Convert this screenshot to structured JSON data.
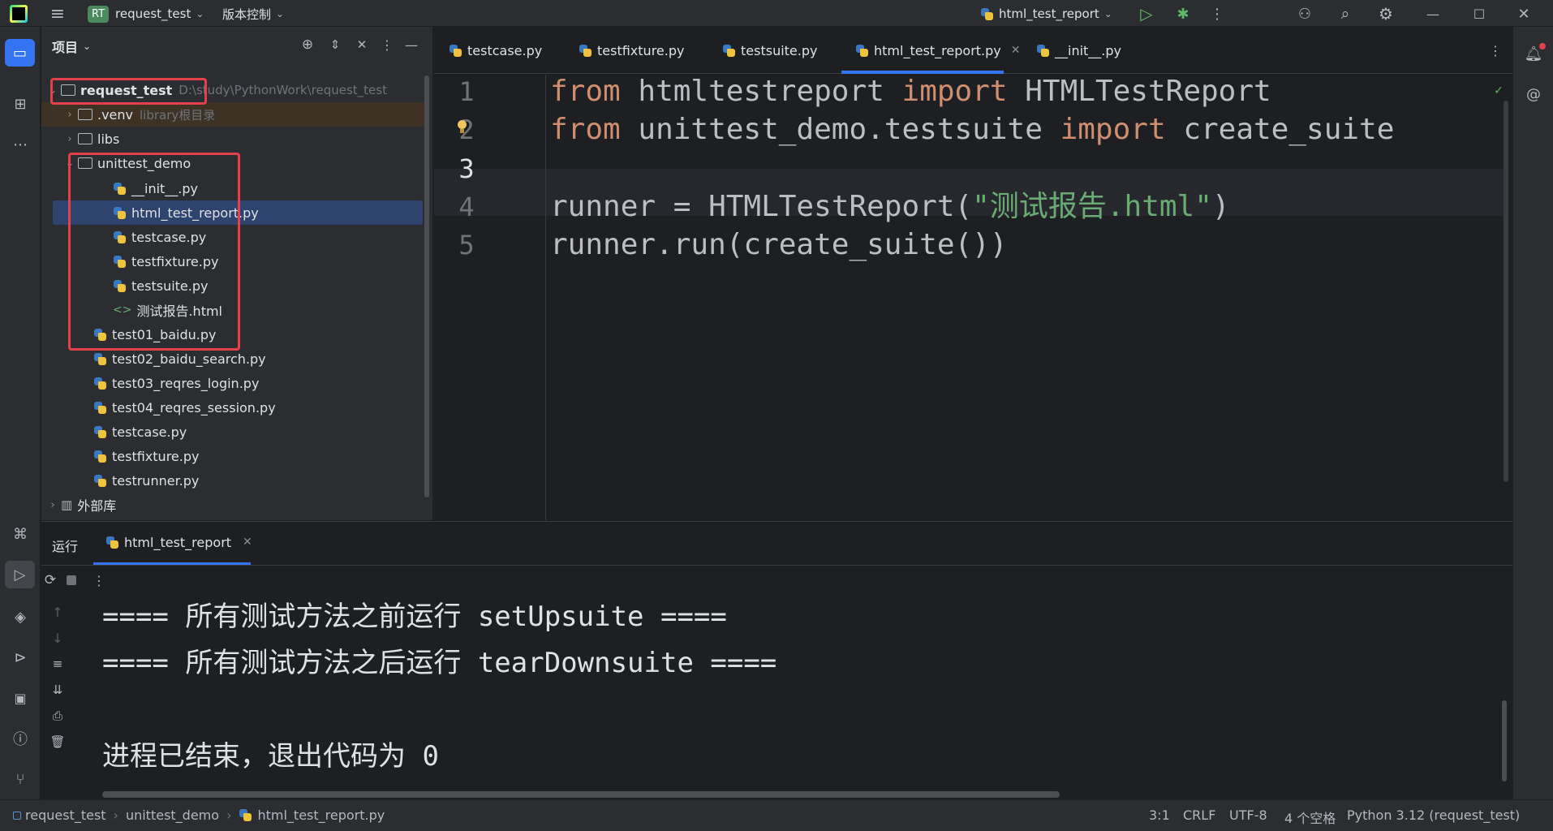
{
  "titlebar": {
    "project_badge": "RT",
    "project_name": "request_test",
    "vcs_menu": "版本控制",
    "run_config": "html_test_report"
  },
  "project_panel": {
    "title": "项目",
    "root_label": "request_test",
    "root_path": "D:\\study\\PythonWork\\request_test",
    "venv_label": ".venv",
    "venv_hint": "library根目录",
    "libs_label": "libs",
    "unittest_folder": "unittest_demo",
    "unittest_files": [
      "__init__.py",
      "html_test_report.py",
      "testcase.py",
      "testfixture.py",
      "testsuite.py",
      "测试报告.html"
    ],
    "root_files": [
      "test01_baidu.py",
      "test02_baidu_search.py",
      "test03_reqres_login.py",
      "test04_reqres_session.py",
      "testcase.py",
      "testfixture.py",
      "testrunner.py"
    ],
    "external_libs": "外部库"
  },
  "tabs": [
    "testcase.py",
    "testfixture.py",
    "testsuite.py",
    "html_test_report.py",
    "__init__.py"
  ],
  "editor": {
    "line_numbers": [
      "1",
      "2",
      "3",
      "4",
      "5"
    ],
    "l1_from": "from",
    "l1_mod": "htmltestreport",
    "l1_import": "import",
    "l1_name": "HTMLTestReport",
    "l2_from": "from",
    "l2_mod": "unittest_demo.testsuite",
    "l2_import": "import",
    "l2_name": "create_suite",
    "l4_pre": "runner = HTMLTestReport(",
    "l4_str": "\"测试报告.html\"",
    "l4_post": ")",
    "l5": "runner.run(create_suite())"
  },
  "run_panel": {
    "title": "运行",
    "tab_label": "html_test_report",
    "output": [
      "==== 所有测试方法之前运行 setUpsuite ====",
      "==== 所有测试方法之后运行 tearDownsuite ====",
      "",
      "进程已结束，退出代码为 0"
    ]
  },
  "statusbar": {
    "breadcrumb": [
      "request_test",
      "unittest_demo",
      "html_test_report.py"
    ],
    "caret": "3:1",
    "line_sep": "CRLF",
    "encoding": "UTF-8",
    "indent": "4 个空格",
    "interpreter": "Python 3.12 (request_test)"
  },
  "colors": {
    "accent": "#3574f0",
    "highlight": "#e5404a",
    "keyword": "#cf8e6d",
    "string": "#6aab73"
  }
}
